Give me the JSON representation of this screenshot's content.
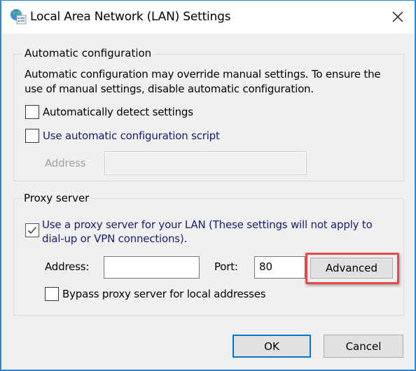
{
  "window": {
    "title": "Local Area Network (LAN) Settings",
    "icon": "network-settings-icon",
    "close_icon": "close-icon"
  },
  "auto_config": {
    "legend": "Automatic configuration",
    "description_line1": "Automatic configuration may override manual settings.  To ensure the",
    "description_line2": "use of manual settings, disable automatic configuration.",
    "auto_detect": {
      "label": "Automatically detect settings",
      "checked": false
    },
    "auto_script": {
      "label": "Use automatic configuration script",
      "checked": false
    },
    "address_label": "Address",
    "address_value": ""
  },
  "proxy": {
    "legend": "Proxy server",
    "use_proxy": {
      "label_line1": "Use a proxy server for your LAN (These settings will not apply to",
      "label_line2": "dial-up or VPN connections).",
      "checked": true
    },
    "address_label": "Address:",
    "address_value": "",
    "port_label": "Port:",
    "port_value": "80",
    "advanced_label": "Advanced",
    "bypass": {
      "label": "Bypass proxy server for local addresses",
      "checked": false
    }
  },
  "buttons": {
    "ok": "OK",
    "cancel": "Cancel"
  },
  "colors": {
    "window_border": "#2b88d8",
    "default_button_border": "#0078d7",
    "highlight": "#e8474b"
  }
}
